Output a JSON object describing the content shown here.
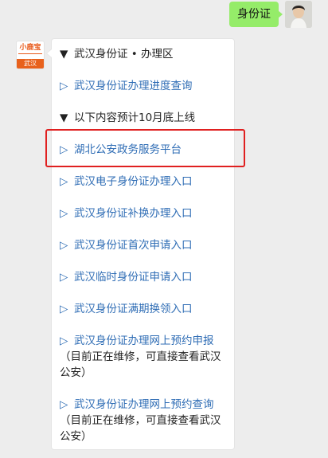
{
  "outgoing": {
    "text": "身份证"
  },
  "sender": {
    "logo_top": "小鹿宝",
    "logo_bottom": "武汉"
  },
  "reply": {
    "header": "武汉身份证 • 办理区",
    "link_1": "武汉身份证办理进度查询",
    "subheader": "以下内容预计10月底上线",
    "link_2": "湖北公安政务服务平台",
    "link_3": "武汉电子身份证办理入口",
    "link_4": "武汉身份证补换办理入口",
    "link_5": "武汉身份证首次申请入口",
    "link_6": "武汉临时身份证申请入口",
    "link_7": "武汉身份证满期换领入口",
    "link_8": "武汉身份证办理网上预约申报",
    "note_8": "（目前正在维修，可直接查看武汉公安）",
    "link_9": "武汉身份证办理网上预约查询",
    "note_9": "（目前正在维修，可直接查看武汉公安）",
    "down_mark": "▼",
    "link_mark": "▷"
  },
  "colors": {
    "link": "#2f6db5",
    "highlight": "#e02020",
    "bubble_green": "#95ec69"
  }
}
